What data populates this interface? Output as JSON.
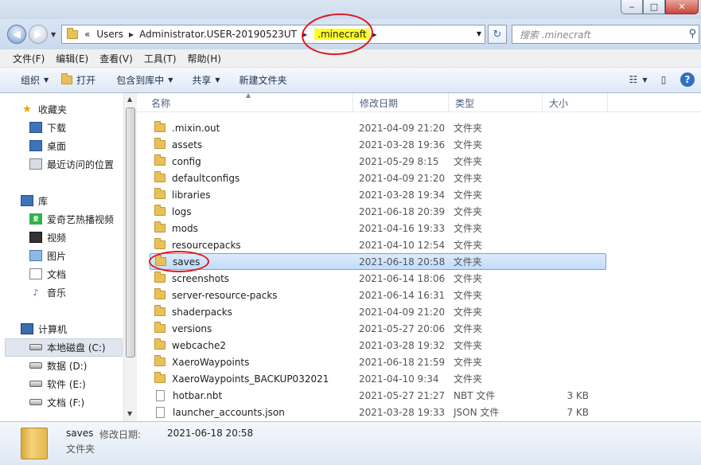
{
  "window": {
    "min_icon": "minimize-icon",
    "max_icon": "maximize-icon",
    "close_icon": "close-icon",
    "min": "‒",
    "max": "□",
    "close": "✕"
  },
  "nav": {
    "back_glyph": "◀",
    "fwd_glyph": "▶",
    "drop_glyph": "▼",
    "refresh_glyph": "↻"
  },
  "address": {
    "overflow": "«",
    "crumbs": [
      "Users",
      "Administrator.USER-20190523UT",
      ".minecraft"
    ],
    "highlight_color": "#ffff22"
  },
  "search": {
    "placeholder": "搜索 .minecraft",
    "icon": "search-icon"
  },
  "menu": [
    "文件(F)",
    "编辑(E)",
    "查看(V)",
    "工具(T)",
    "帮助(H)"
  ],
  "commands": [
    "组织",
    "打开",
    "包含到库中",
    "共享",
    "新建文件夹"
  ],
  "nav_pane": {
    "favorites": {
      "label": "收藏夹",
      "items": [
        "下载",
        "桌面",
        "最近访问的位置"
      ]
    },
    "libraries": {
      "label": "库",
      "items": [
        "爱奇艺热播视频",
        "视频",
        "图片",
        "文档",
        "音乐"
      ]
    },
    "computer": {
      "label": "计算机",
      "items": [
        "本地磁盘 (C:)",
        "数据 (D:)",
        "软件 (E:)",
        "文档 (F:)"
      ]
    },
    "iqiyi_badge": "爱"
  },
  "columns": [
    "名称",
    "修改日期",
    "类型",
    "大小"
  ],
  "files": [
    {
      "name": ".mixin.out",
      "date": "2021-04-09 21:20",
      "type": "文件夹",
      "size": "",
      "kind": "folder"
    },
    {
      "name": "assets",
      "date": "2021-03-28 19:36",
      "type": "文件夹",
      "size": "",
      "kind": "folder"
    },
    {
      "name": "config",
      "date": "2021-05-29 8:15",
      "type": "文件夹",
      "size": "",
      "kind": "folder"
    },
    {
      "name": "defaultconfigs",
      "date": "2021-04-09 21:20",
      "type": "文件夹",
      "size": "",
      "kind": "folder"
    },
    {
      "name": "libraries",
      "date": "2021-03-28 19:34",
      "type": "文件夹",
      "size": "",
      "kind": "folder"
    },
    {
      "name": "logs",
      "date": "2021-06-18 20:39",
      "type": "文件夹",
      "size": "",
      "kind": "folder"
    },
    {
      "name": "mods",
      "date": "2021-04-16 19:33",
      "type": "文件夹",
      "size": "",
      "kind": "folder"
    },
    {
      "name": "resourcepacks",
      "date": "2021-04-10 12:54",
      "type": "文件夹",
      "size": "",
      "kind": "folder"
    },
    {
      "name": "saves",
      "date": "2021-06-18 20:58",
      "type": "文件夹",
      "size": "",
      "kind": "folder",
      "selected": true
    },
    {
      "name": "screenshots",
      "date": "2021-06-14 18:06",
      "type": "文件夹",
      "size": "",
      "kind": "folder"
    },
    {
      "name": "server-resource-packs",
      "date": "2021-06-14 16:31",
      "type": "文件夹",
      "size": "",
      "kind": "folder"
    },
    {
      "name": "shaderpacks",
      "date": "2021-04-09 21:20",
      "type": "文件夹",
      "size": "",
      "kind": "folder"
    },
    {
      "name": "versions",
      "date": "2021-05-27 20:06",
      "type": "文件夹",
      "size": "",
      "kind": "folder"
    },
    {
      "name": "webcache2",
      "date": "2021-03-28 19:32",
      "type": "文件夹",
      "size": "",
      "kind": "folder"
    },
    {
      "name": "XaeroWaypoints",
      "date": "2021-06-18 21:59",
      "type": "文件夹",
      "size": "",
      "kind": "folder"
    },
    {
      "name": "XaeroWaypoints_BACKUP032021",
      "date": "2021-04-10 9:34",
      "type": "文件夹",
      "size": "",
      "kind": "folder"
    },
    {
      "name": "hotbar.nbt",
      "date": "2021-05-27 21:27",
      "type": "NBT 文件",
      "size": "3 KB",
      "kind": "file"
    },
    {
      "name": "launcher_accounts.json",
      "date": "2021-03-28 19:33",
      "type": "JSON 文件",
      "size": "7 KB",
      "kind": "file"
    }
  ],
  "details": {
    "name": "saves",
    "date_label": "修改日期:",
    "date": "2021-06-18 20:58",
    "type": "文件夹"
  },
  "colors": {
    "annotation": "#e0161b",
    "selection": "#c1dcfc"
  }
}
